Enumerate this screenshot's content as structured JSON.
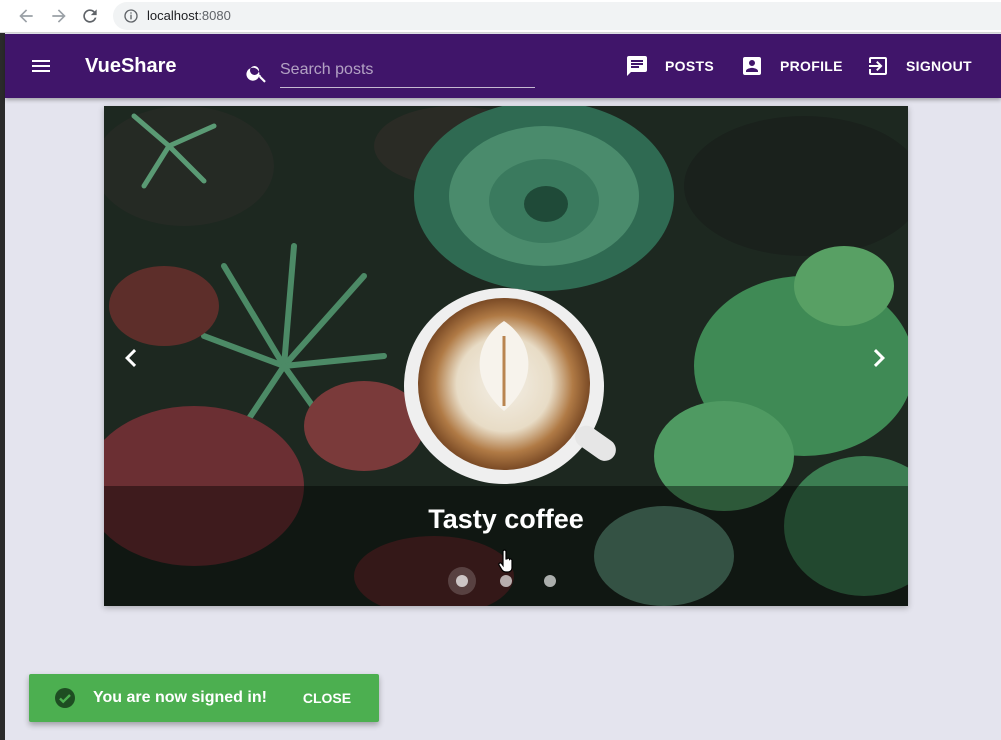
{
  "browser": {
    "url_host": "localhost",
    "url_port": ":8080"
  },
  "appbar": {
    "brand": "VueShare",
    "search": {
      "placeholder": "Search posts",
      "value": ""
    },
    "nav": [
      {
        "label": "POSTS",
        "icon": "message-icon"
      },
      {
        "label": "PROFILE",
        "icon": "account-box-icon"
      },
      {
        "label": "SIGNOUT",
        "icon": "exit-to-app-icon"
      }
    ],
    "colors": {
      "primary": "#40156a"
    }
  },
  "carousel": {
    "caption": "Tasty coffee",
    "slide_count": 3,
    "active_index": 0
  },
  "snackbar": {
    "message": "You are now signed in!",
    "action": "CLOSE",
    "color": "#4caf50",
    "icon": "check-circle-icon"
  }
}
